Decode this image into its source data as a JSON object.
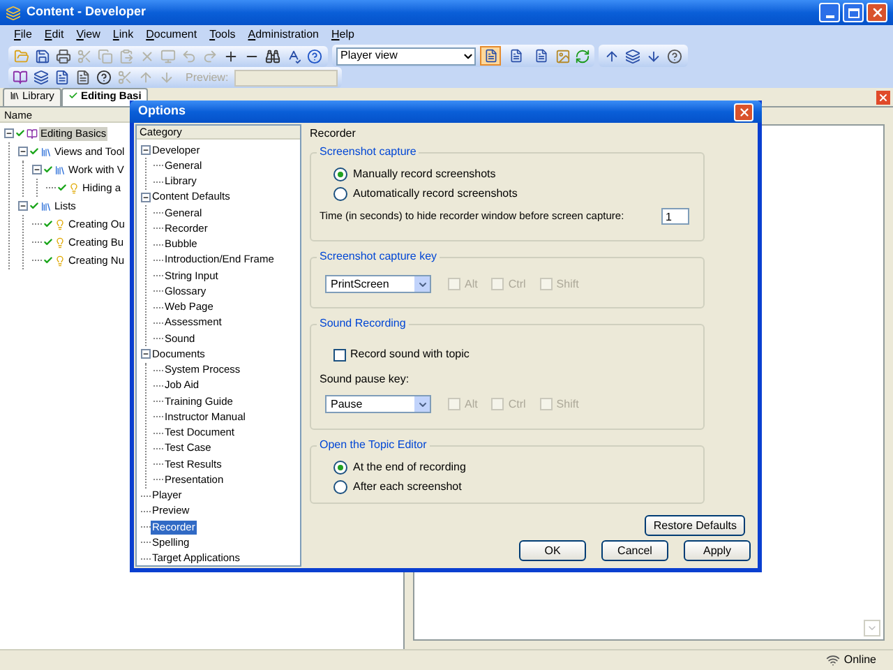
{
  "window": {
    "title": "Content - Developer"
  },
  "menu": [
    "File",
    "Edit",
    "View",
    "Link",
    "Document",
    "Tools",
    "Administration",
    "Help"
  ],
  "toolbar": {
    "buttons": [
      {
        "disabled": false
      },
      {
        "disabled": false
      },
      {
        "disabled": false
      },
      {
        "disabled": true
      },
      {
        "disabled": true
      },
      {
        "disabled": true
      },
      {
        "disabled": true
      },
      {
        "disabled": true
      },
      {
        "disabled": true
      },
      {
        "disabled": true
      },
      {
        "disabled": false
      },
      {
        "disabled": false
      },
      {
        "disabled": false
      },
      {
        "disabled": false
      },
      {
        "disabled": false
      }
    ],
    "view_select": {
      "value": "Player view"
    },
    "layout_buttons": [
      {
        "selected": true
      },
      {
        "selected": false
      },
      {
        "selected": false
      }
    ]
  },
  "toolbar2": {
    "preview_label": "Preview:",
    "preview_disabled": true
  },
  "tabs": [
    {
      "label": "Library",
      "selected": false
    },
    {
      "label": "Editing Basi",
      "selected": true
    }
  ],
  "tree": {
    "header": "Name",
    "items": [
      {
        "label": "Editing Basics",
        "selected": true,
        "kind": "module",
        "children": [
          {
            "label": "Views and Tool",
            "selected": false,
            "kind": "section",
            "children": [
              {
                "label": "Work with V",
                "selected": false,
                "kind": "section",
                "children": [
                  {
                    "label": "Hiding a",
                    "selected": false,
                    "kind": "topic"
                  }
                ]
              }
            ]
          },
          {
            "label": "Lists",
            "selected": false,
            "kind": "section",
            "children": [
              {
                "label": "Creating Ou",
                "selected": false,
                "kind": "topic"
              },
              {
                "label": "Creating Bu",
                "selected": false,
                "kind": "topic"
              },
              {
                "label": "Creating Nu",
                "selected": false,
                "kind": "topic"
              }
            ]
          }
        ]
      }
    ]
  },
  "dialog": {
    "title": "Options",
    "category_header": "Category",
    "categories": [
      {
        "label": "Developer",
        "selected": false,
        "children": [
          {
            "label": "General",
            "selected": false
          },
          {
            "label": "Library",
            "selected": false
          }
        ]
      },
      {
        "label": "Content Defaults",
        "selected": false,
        "children": [
          {
            "label": "General",
            "selected": false
          },
          {
            "label": "Recorder",
            "selected": false
          },
          {
            "label": "Bubble",
            "selected": false
          },
          {
            "label": "Introduction/End Frame",
            "selected": false
          },
          {
            "label": "String Input",
            "selected": false
          },
          {
            "label": "Glossary",
            "selected": false
          },
          {
            "label": "Web Page",
            "selected": false
          },
          {
            "label": "Assessment",
            "selected": false
          },
          {
            "label": "Sound",
            "selected": false
          }
        ]
      },
      {
        "label": "Documents",
        "selected": false,
        "children": [
          {
            "label": "System Process",
            "selected": false
          },
          {
            "label": "Job Aid",
            "selected": false
          },
          {
            "label": "Training Guide",
            "selected": false
          },
          {
            "label": "Instructor Manual",
            "selected": false
          },
          {
            "label": "Test Document",
            "selected": false
          },
          {
            "label": "Test Case",
            "selected": false
          },
          {
            "label": "Test Results",
            "selected": false
          },
          {
            "label": "Presentation",
            "selected": false
          }
        ]
      },
      {
        "label": "Player",
        "selected": false
      },
      {
        "label": "Preview",
        "selected": false
      },
      {
        "label": "Recorder",
        "selected": true
      },
      {
        "label": "Spelling",
        "selected": false
      },
      {
        "label": "Target Applications",
        "selected": false
      }
    ],
    "section": "Recorder",
    "screenshot_capture": {
      "title": "Screenshot capture",
      "options": [
        {
          "label": "Manually record screenshots",
          "selected": true
        },
        {
          "label": "Automatically record screenshots",
          "selected": false
        }
      ],
      "delay_label": "Time (in seconds) to hide recorder window before screen capture:",
      "delay_value": "1"
    },
    "capture_key": {
      "title": "Screenshot capture key",
      "key": "PrintScreen",
      "modifiers": [
        {
          "label": "Alt",
          "checked": false,
          "disabled": true
        },
        {
          "label": "Ctrl",
          "checked": false,
          "disabled": true
        },
        {
          "label": "Shift",
          "checked": false,
          "disabled": true
        }
      ]
    },
    "sound": {
      "title": "Sound Recording",
      "record_label": "Record sound with topic",
      "record_checked": false,
      "pause_label": "Sound pause key:",
      "key": "Pause",
      "modifiers": [
        {
          "label": "Alt",
          "checked": false,
          "disabled": true
        },
        {
          "label": "Ctrl",
          "checked": false,
          "disabled": true
        },
        {
          "label": "Shift",
          "checked": false,
          "disabled": true
        }
      ]
    },
    "topic_editor": {
      "title": "Open the Topic Editor",
      "options": [
        {
          "label": "At the end of recording",
          "selected": true
        },
        {
          "label": "After each screenshot",
          "selected": false
        }
      ]
    },
    "restore_button": "Restore Defaults",
    "buttons": [
      "OK",
      "Cancel",
      "Apply"
    ]
  },
  "status_bar": {
    "status": "Online"
  }
}
